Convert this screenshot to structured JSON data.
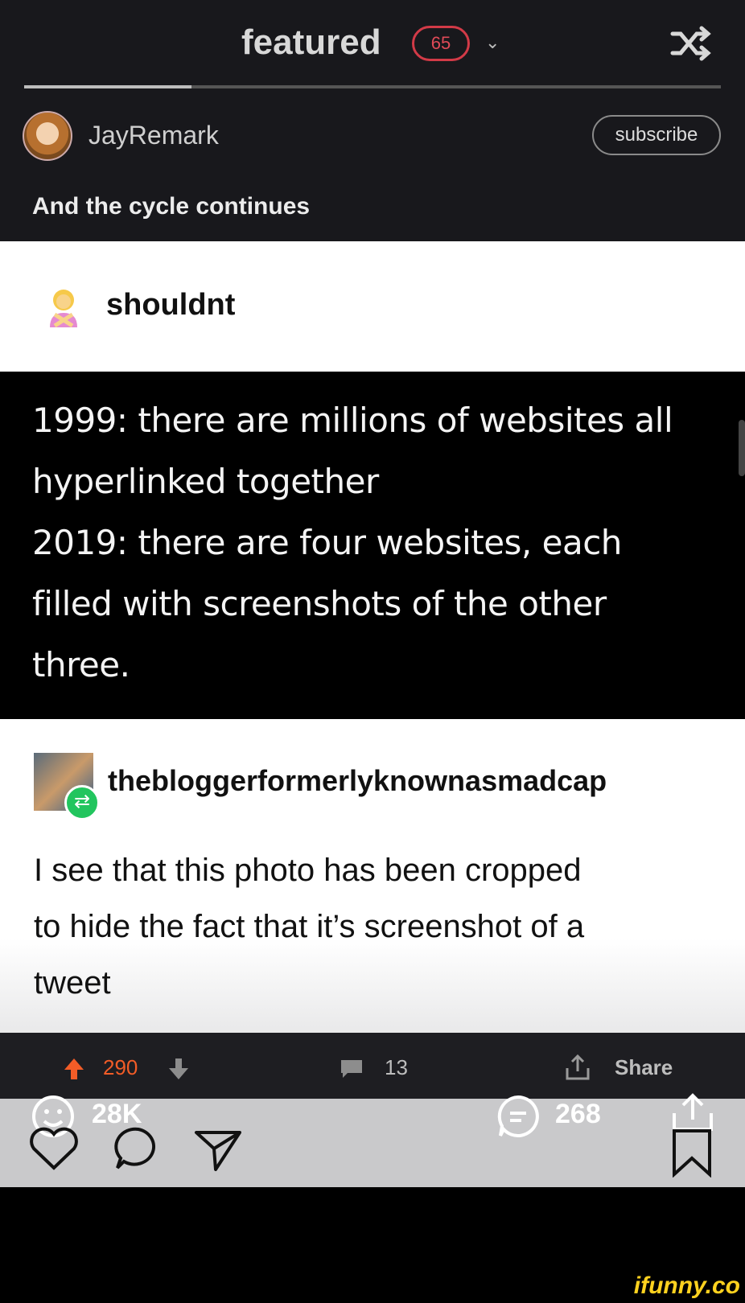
{
  "header": {
    "feed_title": "featured",
    "badge_count": "65",
    "progress": 0.24
  },
  "author": {
    "username": "JayRemark",
    "subscribe_label": "subscribe"
  },
  "caption": "And the cycle continues",
  "post": {
    "author": "shouldnt",
    "tweet_lines": [
      "1999: there are millions of websites all",
      "hyperlinked together",
      "2019: there are four websites, each",
      "filled with screenshots of the other",
      "three."
    ],
    "reblog_author": "thebloggerformerlyknownasmadcap",
    "reblog_lines": [
      "I see that this photo has been cropped",
      "to hide the fact that it’s screenshot of a",
      "tweet"
    ]
  },
  "actions": {
    "votes": "290",
    "comments": "13",
    "share_label": "Share"
  },
  "overlay": {
    "smiles": "28K",
    "comments": "268"
  },
  "brand": "ifunny.co",
  "colors": {
    "badge_red": "#d23a47",
    "upvote_orange": "#f25c27",
    "reblog_green": "#22c55e",
    "brand_yellow": "#ffd21f"
  },
  "icons": [
    "chevron-down-icon",
    "shuffle-icon",
    "upvote-icon",
    "downvote-icon",
    "comment-icon",
    "share-icon",
    "smile-icon",
    "comments-bubble-icon",
    "upload-icon",
    "heart-icon",
    "chat-icon",
    "send-icon",
    "bookmark-icon"
  ]
}
